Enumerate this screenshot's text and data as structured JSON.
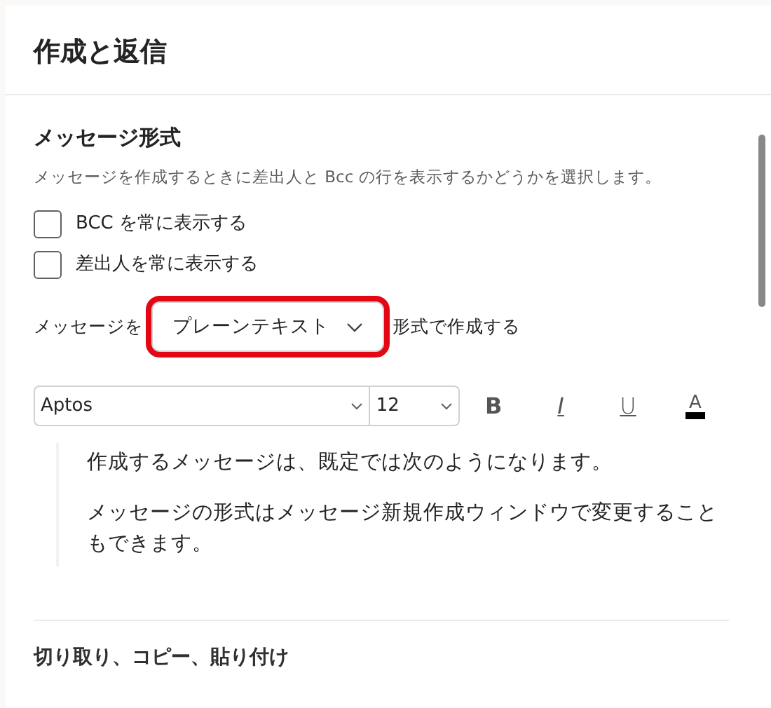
{
  "header": {
    "title": "作成と返信"
  },
  "message_format": {
    "heading": "メッセージ形式",
    "description": "メッセージを作成するときに差出人と Bcc の行を表示するかどうかを選択します。",
    "checkboxes": [
      {
        "label": "BCC を常に表示する",
        "checked": false
      },
      {
        "label": "差出人を常に表示する",
        "checked": false
      }
    ],
    "compose": {
      "prefix": "メッセージを",
      "dropdown": {
        "value": "プレーンテキスト",
        "highlighted": true
      },
      "suffix": "形式で作成する"
    }
  },
  "toolbar": {
    "font": "Aptos",
    "size": "12",
    "buttons": [
      {
        "kind": "bold",
        "label": "B"
      },
      {
        "kind": "italic",
        "label": "I"
      },
      {
        "kind": "underline",
        "label": "U"
      },
      {
        "kind": "color",
        "label": "A"
      }
    ]
  },
  "preview": [
    "作成するメッセージは、既定では次のようになります。",
    "メッセージの形式はメッセージ新規作成ウィンドウで変更することもできます。"
  ],
  "next_section": {
    "heading": "切り取り、コピー、貼り付け"
  }
}
